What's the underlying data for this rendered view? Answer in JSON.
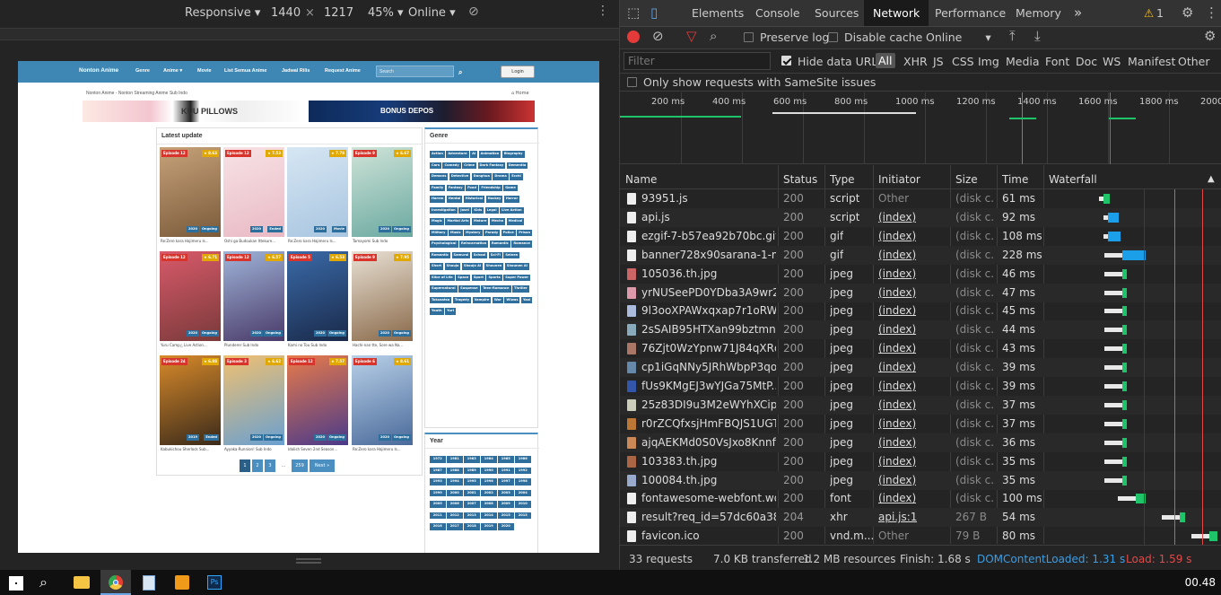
{
  "device_toolbar": {
    "mode": "Responsive",
    "width": "1440",
    "times": "×",
    "height": "1217",
    "zoom": "45%",
    "throttle": "Online"
  },
  "site": {
    "brand": "Nonton Anime",
    "nav": [
      "Genre",
      "Anime ▾",
      "Movie",
      "List Semua Anime",
      "Jadwal Rilis",
      "Request Anime"
    ],
    "search_placeholder": "Search",
    "login": "Login",
    "breadcrumb": "Nonton Anime - Nonton Streaming Anime Sub Indo",
    "home": "Home",
    "banner1_text": "KUU PILLOWS",
    "banner2_text": "BONUS DEPOS",
    "latest_title": "Latest update",
    "cards": [
      {
        "ep": "Episode 12",
        "rating": "8.63",
        "year": "2020",
        "status": "Ongoing",
        "title": "Re:Zero kara Hajimeru Is...",
        "c1": "#c7a27a",
        "c2": "#7a5a3a"
      },
      {
        "ep": "Episode 12",
        "rating": "7.53",
        "year": "2020",
        "status": "Ended",
        "title": "Oshi ga Budoukan Ittekure...",
        "c1": "#f7e3e6",
        "c2": "#e9b9c4"
      },
      {
        "ep": "",
        "rating": "7.78",
        "year": "2020",
        "status": "Movie",
        "title": "Re:Zero kara Hajimeru Is...",
        "c1": "#d6e6f3",
        "c2": "#a8c5e0"
      },
      {
        "ep": "Episode 9",
        "rating": "6.67",
        "year": "2020",
        "status": "Ongoing",
        "title": "Tamayomi Sub Indo",
        "c1": "#cfe3d8",
        "c2": "#6aa9a0"
      },
      {
        "ep": "Episode 12",
        "rating": "6.71",
        "year": "2020",
        "status": "Ongoing",
        "title": "Yuru Camp△ Live Action...",
        "c1": "#d85a6a",
        "c2": "#7a3a3a"
      },
      {
        "ep": "Episode 12",
        "rating": "6.57",
        "year": "2020",
        "status": "Ongoing",
        "title": "Plunderer Sub Indo",
        "c1": "#9fb4d8",
        "c2": "#4a3a6a"
      },
      {
        "ep": "Episode 5",
        "rating": "6.53",
        "year": "2020",
        "status": "Ongoing",
        "title": "Kami no Tou Sub Indo",
        "c1": "#3a6aa8",
        "c2": "#1a2a4a"
      },
      {
        "ep": "Episode 9",
        "rating": "7.95",
        "year": "2020",
        "status": "Ongoing",
        "title": "Hachi-nan tte, Sore wa Na...",
        "c1": "#e8e0d4",
        "c2": "#8a6a4a"
      },
      {
        "ep": "Episode 24",
        "rating": "6.88",
        "year": "2019",
        "status": "Ended",
        "title": "Kabukichou Sherlock Sub...",
        "c1": "#d88a2a",
        "c2": "#3a2a1a"
      },
      {
        "ep": "Episode 3",
        "rating": "6.62",
        "year": "2020",
        "status": "Ongoing",
        "title": "Ayyaka-Runnion! Sub Indo",
        "c1": "#f0c070",
        "c2": "#6aa0d0"
      },
      {
        "ep": "Episode 12",
        "rating": "7.57",
        "year": "2020",
        "status": "Ongoing",
        "title": "Idolish Seven 2nd Season...",
        "c1": "#e87a4a",
        "c2": "#4a3a8a"
      },
      {
        "ep": "Episode 6",
        "rating": "8.61",
        "year": "2020",
        "status": "Ongoing",
        "title": "Re:Zero kara Hajimeru Is...",
        "c1": "#b8d0e8",
        "c2": "#4a6a9a"
      }
    ],
    "pager": [
      "1",
      "2",
      "3",
      "...",
      "259",
      "Next »"
    ],
    "genre_title": "Genre",
    "genres": [
      "Action",
      "Adventure",
      "Ai",
      "Animation",
      "Biography",
      "Cars",
      "Comedy",
      "Crime",
      "Dark Fantasy",
      "Dementia",
      "Demons",
      "Detective",
      "Donghua",
      "Drama",
      "Ecchi",
      "Family",
      "Fantasy",
      "Food",
      "Friendship",
      "Game",
      "Harem",
      "Hentai",
      "Historical",
      "Hockey",
      "Horror",
      "Investigation",
      "Josei",
      "Kids",
      "Legal",
      "Live Action",
      "Magic",
      "Martial Arts",
      "Mature",
      "Mecha",
      "Medical",
      "Military",
      "Music",
      "Mystery",
      "Parody",
      "Police",
      "Prison",
      "Psychological",
      "Reincarnation",
      "Romantic",
      "Romance",
      "Romantic",
      "Samurai",
      "School",
      "Sci-Fi",
      "Seinen",
      "Short",
      "Shoujo",
      "Shoujo Ai",
      "Shounen",
      "Shounen Ai",
      "Slice of Life",
      "Space",
      "Sport",
      "Sports",
      "Super Power",
      "Supernatural",
      "Suspense",
      "Teen-Romance",
      "Thriller",
      "Tokusatsu",
      "Tragedy",
      "Vampire",
      "War",
      "Wiwas",
      "Yaoi",
      "Youth",
      "Yuri"
    ],
    "year_title": "Year",
    "years": [
      "1972",
      "1981",
      "1983",
      "1984",
      "1985",
      "1986",
      "1987",
      "1988",
      "1989",
      "1990",
      "1991",
      "1992",
      "1993",
      "1994",
      "1995",
      "1996",
      "1997",
      "1998",
      "1999",
      "2000",
      "2001",
      "2002",
      "2003",
      "2004",
      "2005",
      "2006",
      "2007",
      "2008",
      "2009",
      "2010",
      "2011",
      "2012",
      "2013",
      "2014",
      "2015",
      "2015",
      "2016",
      "2017",
      "2018",
      "2019",
      "2020"
    ]
  },
  "devtools": {
    "tabs": [
      "Elements",
      "Console",
      "Sources",
      "Network",
      "Performance",
      "Memory"
    ],
    "more": "»",
    "warnings": "1",
    "preserve_log": "Preserve log",
    "disable_cache": "Disable cache",
    "online": "Online",
    "filter_placeholder": "Filter",
    "hide_data_urls": "Hide data URLs",
    "filter_types": [
      "All",
      "XHR",
      "JS",
      "CSS",
      "Img",
      "Media",
      "Font",
      "Doc",
      "WS",
      "Manifest",
      "Other"
    ],
    "samesite": "Only show requests with SameSite issues",
    "overview_ticks": [
      "200 ms",
      "400 ms",
      "600 ms",
      "800 ms",
      "1000 ms",
      "1200 ms",
      "1400 ms",
      "1600 ms",
      "1800 ms",
      "2000"
    ],
    "columns": [
      "Name",
      "Status",
      "Type",
      "Initiator",
      "Size",
      "Time",
      "Waterfall"
    ],
    "rows": [
      {
        "name": "93951.js",
        "status": "200",
        "type": "script",
        "initiator": "Other",
        "size": "(disk c...",
        "time": "61 ms",
        "icon": "#eee",
        "wf_start": 0.33,
        "wf_len": 0.04,
        "wf_color": "#1ec36a"
      },
      {
        "name": "api.js",
        "status": "200",
        "type": "script",
        "initiator": "(index)",
        "size": "(disk c...",
        "time": "92 ms",
        "icon": "#eee",
        "wf_start": 0.36,
        "wf_len": 0.06,
        "wf_color": "#1a9fe8"
      },
      {
        "name": "ezgif-7-b57ea92b70bc.gif",
        "status": "200",
        "type": "gif",
        "initiator": "(index)",
        "size": "(disk c...",
        "time": "108 ms",
        "icon": "#eee",
        "wf_start": 0.36,
        "wf_len": 0.07,
        "wf_color": "#1a9fe8"
      },
      {
        "name": "banner728x90sarana-1-mi...",
        "status": "200",
        "type": "gif",
        "initiator": "(index)",
        "size": "(disk c...",
        "time": "228 ms",
        "icon": "#eee",
        "wf_start": 0.44,
        "wf_len": 0.14,
        "wf_color": "#1a9fe8"
      },
      {
        "name": "105036.th.jpg",
        "status": "200",
        "type": "jpeg",
        "initiator": "(index)",
        "size": "(disk c...",
        "time": "46 ms",
        "icon": "#c66",
        "wf_start": 0.44,
        "wf_len": 0.03,
        "wf_color": "#1ec36a"
      },
      {
        "name": "yrNUSeePD0YDba3A9wr2l...",
        "status": "200",
        "type": "jpeg",
        "initiator": "(index)",
        "size": "(disk c...",
        "time": "47 ms",
        "icon": "#d9a",
        "wf_start": 0.44,
        "wf_len": 0.03,
        "wf_color": "#1ec36a"
      },
      {
        "name": "9l3ooXPAWxqxap7r1oRW...",
        "status": "200",
        "type": "jpeg",
        "initiator": "(index)",
        "size": "(disk c...",
        "time": "45 ms",
        "icon": "#abd",
        "wf_start": 0.44,
        "wf_len": 0.03,
        "wf_color": "#1ec36a"
      },
      {
        "name": "2sSAIB95HTXan99bztmniy...",
        "status": "200",
        "type": "jpeg",
        "initiator": "(index)",
        "size": "(disk c...",
        "time": "44 ms",
        "icon": "#8ab",
        "wf_start": 0.44,
        "wf_len": 0.03,
        "wf_color": "#1ec36a"
      },
      {
        "name": "76Zjt0WzYpnw71J84qXRq...",
        "status": "200",
        "type": "jpeg",
        "initiator": "(index)",
        "size": "(disk c...",
        "time": "43 ms",
        "icon": "#a76",
        "wf_start": 0.44,
        "wf_len": 0.03,
        "wf_color": "#1ec36a"
      },
      {
        "name": "cp1iGqNNy5JRhWbpP3qo...",
        "status": "200",
        "type": "jpeg",
        "initiator": "(index)",
        "size": "(disk c...",
        "time": "39 ms",
        "icon": "#68a",
        "wf_start": 0.44,
        "wf_len": 0.03,
        "wf_color": "#1ec36a"
      },
      {
        "name": "fUs9KMgEJ3wYJGa75MtP...",
        "status": "200",
        "type": "jpeg",
        "initiator": "(index)",
        "size": "(disk c...",
        "time": "39 ms",
        "icon": "#35a",
        "wf_start": 0.44,
        "wf_len": 0.03,
        "wf_color": "#1ec36a"
      },
      {
        "name": "25z83DI9u3M2eWYhXCip...",
        "status": "200",
        "type": "jpeg",
        "initiator": "(index)",
        "size": "(disk c...",
        "time": "37 ms",
        "icon": "#ccb",
        "wf_start": 0.44,
        "wf_len": 0.03,
        "wf_color": "#1ec36a"
      },
      {
        "name": "r0rZCQfxsjHmFBQJS1UGTi...",
        "status": "200",
        "type": "jpeg",
        "initiator": "(index)",
        "size": "(disk c...",
        "time": "37 ms",
        "icon": "#b73",
        "wf_start": 0.44,
        "wf_len": 0.03,
        "wf_color": "#1ec36a"
      },
      {
        "name": "ajqAEKMd0S0VsJxo8Knnft...",
        "status": "200",
        "type": "jpeg",
        "initiator": "(index)",
        "size": "(disk c...",
        "time": "36 ms",
        "icon": "#c85",
        "wf_start": 0.44,
        "wf_len": 0.03,
        "wf_color": "#1ec36a"
      },
      {
        "name": "103383.th.jpg",
        "status": "200",
        "type": "jpeg",
        "initiator": "(index)",
        "size": "(disk c...",
        "time": "35 ms",
        "icon": "#a64",
        "wf_start": 0.44,
        "wf_len": 0.03,
        "wf_color": "#1ec36a"
      },
      {
        "name": "100084.th.jpg",
        "status": "200",
        "type": "jpeg",
        "initiator": "(index)",
        "size": "(disk c...",
        "time": "35 ms",
        "icon": "#9ac",
        "wf_start": 0.44,
        "wf_len": 0.03,
        "wf_color": "#1ec36a"
      },
      {
        "name": "fontawesome-webfont.wo...",
        "status": "200",
        "type": "font",
        "initiator": "(index)",
        "size": "(disk c...",
        "time": "100 ms",
        "icon": "#eee",
        "wf_start": 0.52,
        "wf_len": 0.06,
        "wf_color": "#1ec36a"
      },
      {
        "name": "result?req_id=57dc60a389...",
        "status": "204",
        "type": "xhr",
        "initiator": "api.js:1",
        "size": "267 B",
        "time": "54 ms",
        "icon": "#eee",
        "wf_start": 0.78,
        "wf_len": 0.03,
        "wf_color": "#1ec36a"
      },
      {
        "name": "favicon.ico",
        "status": "200",
        "type": "vnd.m...",
        "initiator": "Other",
        "size": "79 B",
        "time": "80 ms",
        "icon": "#eee",
        "wf_start": 0.95,
        "wf_len": 0.05,
        "wf_color": "#1ec36a"
      }
    ],
    "status_bar": {
      "requests": "33 requests",
      "transferred": "7.0 KB transferred",
      "resources": "1.2 MB resources",
      "finish": "Finish: 1.68 s",
      "dcl": "DOMContentLoaded: 1.31 s",
      "load": "Load: 1.59 s"
    },
    "colors": {
      "dcl": "#3a8ee6",
      "load": "#e34848",
      "accent": "#4a8fc0"
    }
  },
  "taskbar": {
    "clock": "00.48"
  }
}
